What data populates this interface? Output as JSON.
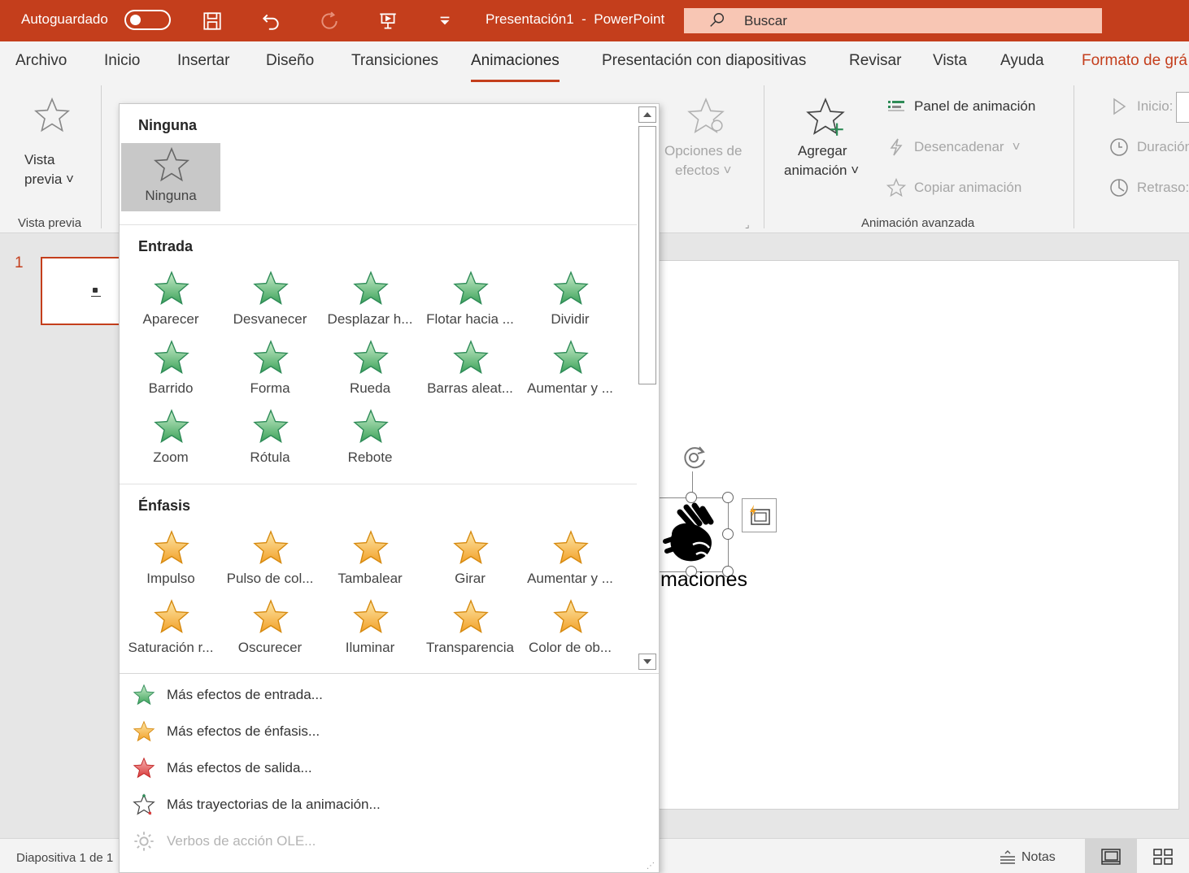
{
  "titlebar": {
    "autosave_label": "Autoguardado",
    "doc_name": "Presentación1",
    "separator": "-",
    "app_name": "PowerPoint",
    "search_placeholder": "Buscar",
    "accent": "#c43e1c"
  },
  "tabs": [
    {
      "label": "Archivo"
    },
    {
      "label": "Inicio"
    },
    {
      "label": "Insertar"
    },
    {
      "label": "Diseño"
    },
    {
      "label": "Transiciones"
    },
    {
      "label": "Animaciones",
      "active": true
    },
    {
      "label": "Presentación con diapositivas"
    },
    {
      "label": "Revisar"
    },
    {
      "label": "Vista"
    },
    {
      "label": "Ayuda"
    },
    {
      "label": "Formato de grá"
    }
  ],
  "ribbon": {
    "preview": {
      "line1": "Vista",
      "line2": "previa",
      "group": "Vista previa"
    },
    "effect_options": {
      "line1": "Opciones de",
      "line2": "efectos"
    },
    "add_animation": {
      "line1": "Agregar",
      "line2": "animación"
    },
    "animation_pane": "Panel de animación",
    "trigger": "Desencadenar",
    "copy_animation": "Copiar animación",
    "advanced_group": "Animación avanzada",
    "start": "Inicio:",
    "duration": "Duración",
    "delay": "Retraso:"
  },
  "slides": {
    "number": "1"
  },
  "slide_text": "maciones",
  "gallery": {
    "none_section": "Ninguna",
    "none_item": "Ninguna",
    "entrance_section": "Entrada",
    "entrance": [
      "Aparecer",
      "Desvanecer",
      "Desplazar h...",
      "Flotar hacia ...",
      "Dividir",
      "Barrido",
      "Forma",
      "Rueda",
      "Barras aleat...",
      "Aumentar y ...",
      "Zoom",
      "Rótula",
      "Rebote"
    ],
    "emphasis_section": "Énfasis",
    "emphasis": [
      "Impulso",
      "Pulso de col...",
      "Tambalear",
      "Girar",
      "Aumentar y ...",
      "Saturación r...",
      "Oscurecer",
      "Iluminar",
      "Transparencia",
      "Color de ob..."
    ],
    "menu": [
      {
        "label": "Más efectos de entrada...",
        "icon": "green-star-icon"
      },
      {
        "label": "Más efectos de énfasis...",
        "icon": "orange-star-icon"
      },
      {
        "label": "Más efectos de salida...",
        "icon": "red-star-icon"
      },
      {
        "label": "Más trayectorias de la animación...",
        "icon": "motion-path-star-icon"
      },
      {
        "label": "Verbos de acción OLE...",
        "icon": "gear-icon",
        "disabled": true
      }
    ]
  },
  "statusbar": {
    "slide_info": "Diapositiva 1 de 1",
    "notes": "Notas"
  }
}
